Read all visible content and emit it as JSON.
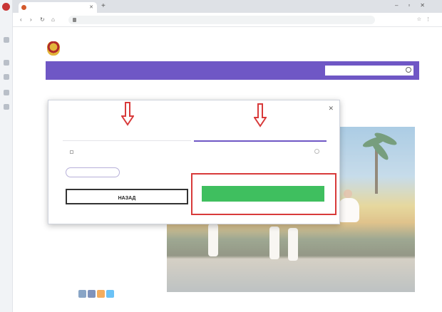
{
  "browser": {
    "tab_title": "",
    "url": "",
    "colors": {
      "tab_strip": "#dee1e6",
      "favicon": "#c83535"
    }
  },
  "site": {
    "org_name": "",
    "header_link": "",
    "nav_items": [
      "",
      "",
      "",
      "",
      "",
      "",
      ""
    ],
    "search_placeholder": "",
    "breadcrumb": "",
    "colors": {
      "nav_bg": "#6f57c5"
    }
  },
  "page": {
    "info_labels": [
      "",
      "",
      ""
    ],
    "share_label": "",
    "bottom_tabs": [
      "",
      "",
      "",
      "",
      "",
      ""
    ],
    "photo_sign": ""
  },
  "modal": {
    "subtitle": "",
    "title": "",
    "step1_label": "",
    "step2_label": "",
    "checkbox_label": "",
    "outline_button": "",
    "back_button": "НАЗАД",
    "next_button": "",
    "colors": {
      "next": "#3fbf5f",
      "highlight": "#d83a3a",
      "arrow": "#d83a3a"
    }
  }
}
